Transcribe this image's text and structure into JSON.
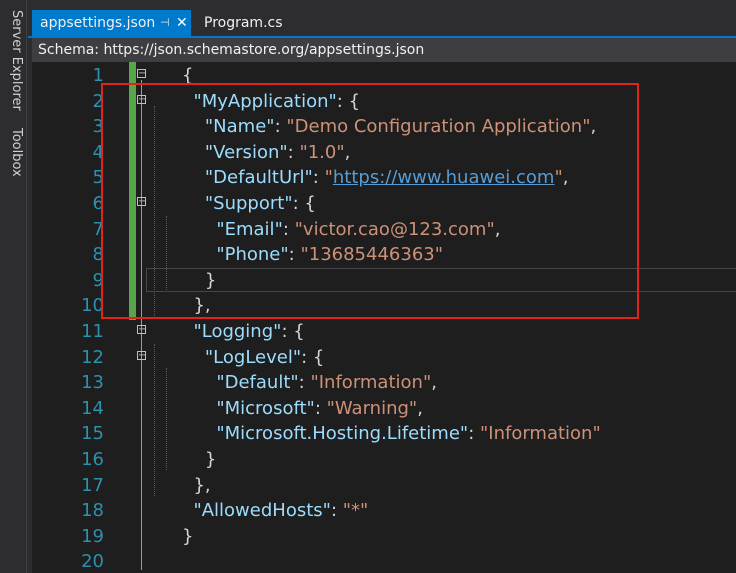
{
  "sidebar": {
    "tabs": [
      "Server Explorer",
      "Toolbox"
    ]
  },
  "tabs": [
    {
      "label": "appsettings.json",
      "active": true
    },
    {
      "label": "Program.cs",
      "active": false
    }
  ],
  "schema": {
    "text": "Schema:  https://json.schemastore.org/appsettings.json"
  },
  "icons": {
    "pin": "pin-icon",
    "close": "close-icon",
    "fold": "collapse-toggle-icon"
  },
  "colors": {
    "accent": "#007acc",
    "highlight_box": "#e2231a",
    "key": "#9cdcfe",
    "string": "#ce9178",
    "line_number": "#2b91af"
  },
  "editor": {
    "lines": [
      {
        "n": "1",
        "parts": [
          [
            "punc",
            "{"
          ]
        ]
      },
      {
        "n": "2",
        "parts": [
          [
            "punc",
            "  "
          ],
          [
            "key",
            "\"MyApplication\""
          ],
          [
            "punc",
            ": {"
          ]
        ]
      },
      {
        "n": "3",
        "parts": [
          [
            "punc",
            "    "
          ],
          [
            "key",
            "\"Name\""
          ],
          [
            "punc",
            ": "
          ],
          [
            "str",
            "\"Demo Configuration Application\""
          ],
          [
            "punc",
            ","
          ]
        ]
      },
      {
        "n": "4",
        "parts": [
          [
            "punc",
            "    "
          ],
          [
            "key",
            "\"Version\""
          ],
          [
            "punc",
            ": "
          ],
          [
            "str",
            "\"1.0\""
          ],
          [
            "punc",
            ","
          ]
        ]
      },
      {
        "n": "5",
        "parts": [
          [
            "punc",
            "    "
          ],
          [
            "key",
            "\"DefaultUrl\""
          ],
          [
            "punc",
            ": "
          ],
          [
            "str",
            "\""
          ],
          [
            "link",
            "https://www.huawei.com"
          ],
          [
            "str",
            "\""
          ],
          [
            "punc",
            ","
          ]
        ]
      },
      {
        "n": "6",
        "parts": [
          [
            "punc",
            "    "
          ],
          [
            "key",
            "\"Support\""
          ],
          [
            "punc",
            ": {"
          ]
        ]
      },
      {
        "n": "7",
        "parts": [
          [
            "punc",
            "      "
          ],
          [
            "key",
            "\"Email\""
          ],
          [
            "punc",
            ": "
          ],
          [
            "str",
            "\"victor.cao@123.com\""
          ],
          [
            "punc",
            ","
          ]
        ]
      },
      {
        "n": "8",
        "parts": [
          [
            "punc",
            "      "
          ],
          [
            "key",
            "\"Phone\""
          ],
          [
            "punc",
            ": "
          ],
          [
            "str",
            "\"13685446363\""
          ]
        ]
      },
      {
        "n": "9",
        "parts": [
          [
            "punc",
            "    }"
          ]
        ]
      },
      {
        "n": "10",
        "parts": [
          [
            "punc",
            "  },"
          ]
        ]
      },
      {
        "n": "11",
        "parts": [
          [
            "punc",
            "  "
          ],
          [
            "key",
            "\"Logging\""
          ],
          [
            "punc",
            ": {"
          ]
        ]
      },
      {
        "n": "12",
        "parts": [
          [
            "punc",
            "    "
          ],
          [
            "key",
            "\"LogLevel\""
          ],
          [
            "punc",
            ": {"
          ]
        ]
      },
      {
        "n": "13",
        "parts": [
          [
            "punc",
            "      "
          ],
          [
            "key",
            "\"Default\""
          ],
          [
            "punc",
            ": "
          ],
          [
            "str",
            "\"Information\""
          ],
          [
            "punc",
            ","
          ]
        ]
      },
      {
        "n": "14",
        "parts": [
          [
            "punc",
            "      "
          ],
          [
            "key",
            "\"Microsoft\""
          ],
          [
            "punc",
            ": "
          ],
          [
            "str",
            "\"Warning\""
          ],
          [
            "punc",
            ","
          ]
        ]
      },
      {
        "n": "15",
        "parts": [
          [
            "punc",
            "      "
          ],
          [
            "key",
            "\"Microsoft.Hosting.Lifetime\""
          ],
          [
            "punc",
            ": "
          ],
          [
            "str",
            "\"Information\""
          ]
        ]
      },
      {
        "n": "16",
        "parts": [
          [
            "punc",
            "    }"
          ]
        ]
      },
      {
        "n": "17",
        "parts": [
          [
            "punc",
            "  },"
          ]
        ]
      },
      {
        "n": "18",
        "parts": [
          [
            "punc",
            "  "
          ],
          [
            "key",
            "\"AllowedHosts\""
          ],
          [
            "punc",
            ": "
          ],
          [
            "str",
            "\"*\""
          ]
        ]
      },
      {
        "n": "19",
        "parts": [
          [
            "punc",
            "}"
          ]
        ]
      },
      {
        "n": "20",
        "parts": []
      }
    ],
    "foldable_lines": [
      "1",
      "2",
      "6",
      "11",
      "12"
    ]
  }
}
